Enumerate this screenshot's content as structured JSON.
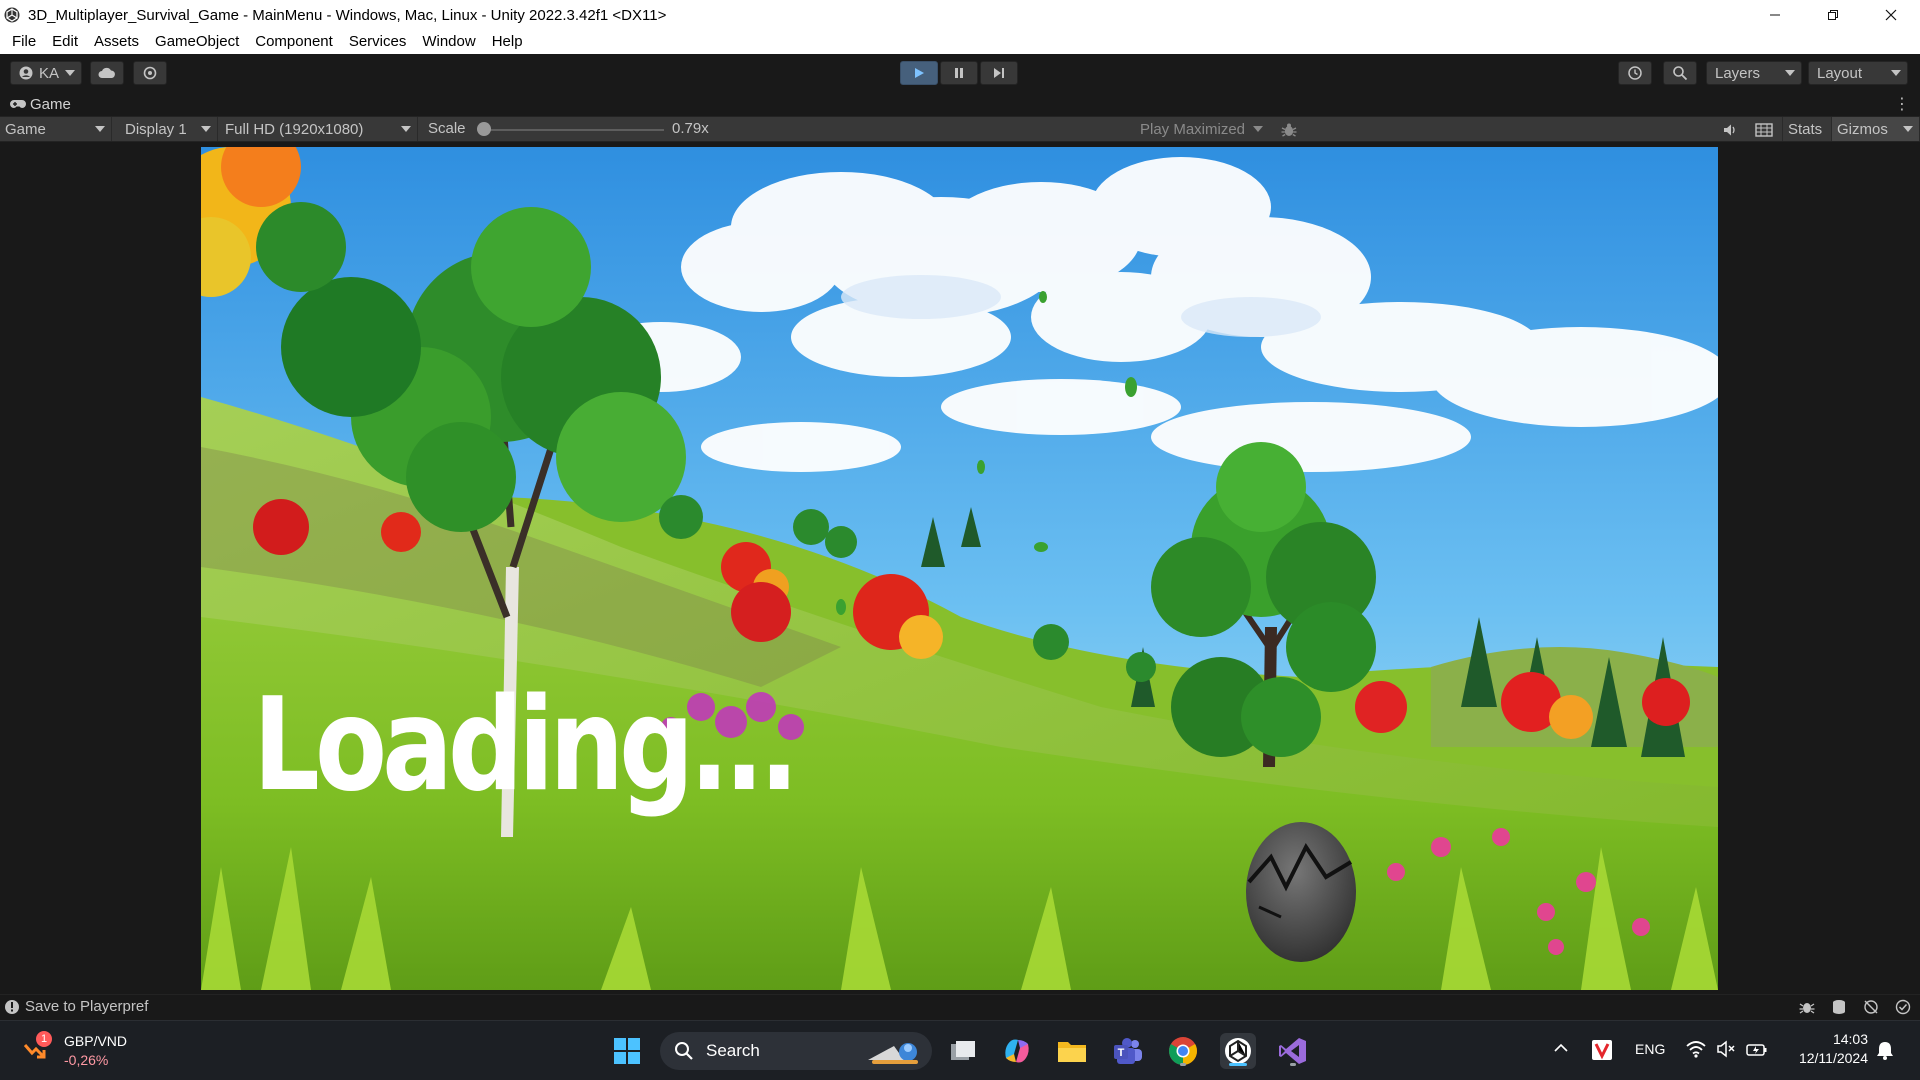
{
  "window": {
    "title": "3D_Multiplayer_Survival_Game - MainMenu - Windows, Mac, Linux - Unity 2022.3.42f1 <DX11>"
  },
  "menubar": {
    "items": [
      "File",
      "Edit",
      "Assets",
      "GameObject",
      "Component",
      "Services",
      "Window",
      "Help"
    ]
  },
  "toolbar": {
    "account_label": "KA",
    "layers_label": "Layers",
    "layout_label": "Layout",
    "play_active": true
  },
  "game_tab": {
    "label": "Game"
  },
  "game_controls": {
    "mode": "Game",
    "display": "Display 1",
    "resolution": "Full HD (1920x1080)",
    "scale_label": "Scale",
    "scale_value": "0.79x",
    "play_mode": "Play Maximized",
    "stats_label": "Stats",
    "gizmos_label": "Gizmos"
  },
  "game_view": {
    "loading_text": "Loading..."
  },
  "statusbar": {
    "message": "Save to Playerpref"
  },
  "taskbar": {
    "ticker_symbol": "GBP/VND",
    "ticker_change": "-0,26%",
    "ticker_badge": "1",
    "search_label": "Search",
    "language": "ENG",
    "time": "14:03",
    "date": "12/11/2024",
    "colors": {
      "active_indicator": "#4cc2ff",
      "ticker_negative": "#ff99a4"
    }
  }
}
